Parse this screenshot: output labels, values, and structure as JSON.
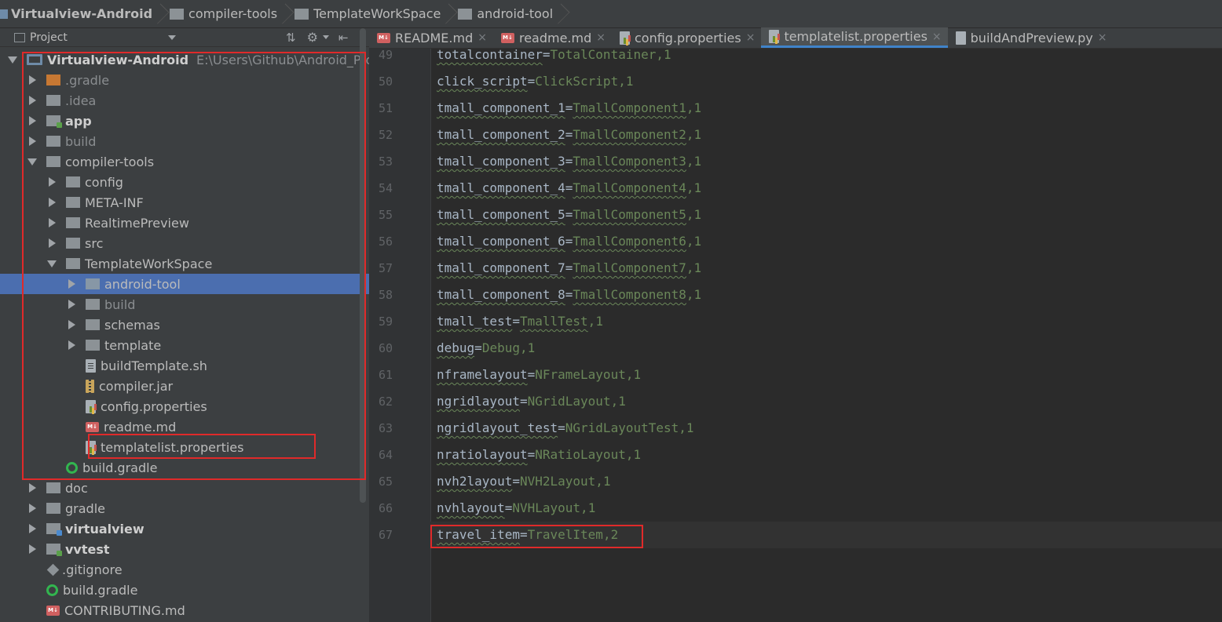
{
  "breadcrumbs": [
    "Virtualview-Android",
    "compiler-tools",
    "TemplateWorkSpace",
    "android-tool"
  ],
  "project_panel": {
    "title": "Project",
    "tree": [
      {
        "label": "Virtualview-Android",
        "path": "E:\\Users\\Github\\Android_Proje",
        "indent": 0,
        "arrow": "down",
        "icon": "project",
        "style": "bold"
      },
      {
        "label": ".gradle",
        "indent": 1,
        "arrow": "right",
        "icon": "folder-orange",
        "style": "dim"
      },
      {
        "label": ".idea",
        "indent": 1,
        "arrow": "right",
        "icon": "folder",
        "style": "dim"
      },
      {
        "label": "app",
        "indent": 1,
        "arrow": "right",
        "icon": "module",
        "style": "bold"
      },
      {
        "label": "build",
        "indent": 1,
        "arrow": "right",
        "icon": "folder",
        "style": "dim"
      },
      {
        "label": "compiler-tools",
        "indent": 1,
        "arrow": "down",
        "icon": "folder",
        "style": ""
      },
      {
        "label": "config",
        "indent": 2,
        "arrow": "right",
        "icon": "folder",
        "style": ""
      },
      {
        "label": "META-INF",
        "indent": 2,
        "arrow": "right",
        "icon": "folder",
        "style": ""
      },
      {
        "label": "RealtimePreview",
        "indent": 2,
        "arrow": "right",
        "icon": "folder",
        "style": ""
      },
      {
        "label": "src",
        "indent": 2,
        "arrow": "right",
        "icon": "folder",
        "style": ""
      },
      {
        "label": "TemplateWorkSpace",
        "indent": 2,
        "arrow": "down",
        "icon": "folder",
        "style": ""
      },
      {
        "label": "android-tool",
        "indent": 3,
        "arrow": "right",
        "icon": "folder-blue",
        "style": "",
        "selected": true
      },
      {
        "label": "build",
        "indent": 3,
        "arrow": "right",
        "icon": "folder",
        "style": "dim"
      },
      {
        "label": "schemas",
        "indent": 3,
        "arrow": "right",
        "icon": "folder",
        "style": ""
      },
      {
        "label": "template",
        "indent": 3,
        "arrow": "right",
        "icon": "folder",
        "style": ""
      },
      {
        "label": "buildTemplate.sh",
        "indent": 3,
        "arrow": "none",
        "icon": "file-sh",
        "style": ""
      },
      {
        "label": "compiler.jar",
        "indent": 3,
        "arrow": "none",
        "icon": "file-jar",
        "style": ""
      },
      {
        "label": "config.properties",
        "indent": 3,
        "arrow": "none",
        "icon": "file-props",
        "style": ""
      },
      {
        "label": "readme.md",
        "indent": 3,
        "arrow": "none",
        "icon": "file-md",
        "style": ""
      },
      {
        "label": "templatelist.properties",
        "indent": 3,
        "arrow": "none",
        "icon": "file-props",
        "style": ""
      },
      {
        "label": "build.gradle",
        "indent": 2,
        "arrow": "none",
        "icon": "gradle",
        "style": ""
      },
      {
        "label": "doc",
        "indent": 1,
        "arrow": "right",
        "icon": "folder",
        "style": ""
      },
      {
        "label": "gradle",
        "indent": 1,
        "arrow": "right",
        "icon": "folder",
        "style": ""
      },
      {
        "label": "virtualview",
        "indent": 1,
        "arrow": "right",
        "icon": "module-vv",
        "style": "bold"
      },
      {
        "label": "vvtest",
        "indent": 1,
        "arrow": "right",
        "icon": "module",
        "style": "bold"
      },
      {
        "label": ".gitignore",
        "indent": 1,
        "arrow": "none",
        "icon": "git",
        "style": ""
      },
      {
        "label": "build.gradle",
        "indent": 1,
        "arrow": "none",
        "icon": "gradle",
        "style": ""
      },
      {
        "label": "CONTRIBUTING.md",
        "indent": 1,
        "arrow": "none",
        "icon": "file-md",
        "style": ""
      }
    ]
  },
  "tabs": [
    {
      "label": "README.md",
      "icon": "file-md",
      "active": false
    },
    {
      "label": "readme.md",
      "icon": "file-md",
      "active": false
    },
    {
      "label": "config.properties",
      "icon": "file-props",
      "active": false
    },
    {
      "label": "templatelist.properties",
      "icon": "file-props",
      "active": true
    },
    {
      "label": "buildAndPreview.py",
      "icon": "file-py",
      "active": false
    }
  ],
  "editor": {
    "lines": [
      {
        "n": "49",
        "key": "totalcontainer",
        "value": "TotalContainer",
        "num": "1"
      },
      {
        "n": "50",
        "key": "click_script",
        "value": "ClickScript",
        "num": "1"
      },
      {
        "n": "51",
        "key": "tmall_component_1",
        "value": "TmallComponent1",
        "num": "1"
      },
      {
        "n": "52",
        "key": "tmall_component_2",
        "value": "TmallComponent2",
        "num": "1"
      },
      {
        "n": "53",
        "key": "tmall_component_3",
        "value": "TmallComponent3",
        "num": "1"
      },
      {
        "n": "54",
        "key": "tmall_component_4",
        "value": "TmallComponent4",
        "num": "1"
      },
      {
        "n": "55",
        "key": "tmall_component_5",
        "value": "TmallComponent5",
        "num": "1"
      },
      {
        "n": "56",
        "key": "tmall_component_6",
        "value": "TmallComponent6",
        "num": "1"
      },
      {
        "n": "57",
        "key": "tmall_component_7",
        "value": "TmallComponent7",
        "num": "1"
      },
      {
        "n": "58",
        "key": "tmall_component_8",
        "value": "TmallComponent8",
        "num": "1"
      },
      {
        "n": "59",
        "key": "tmall_test",
        "value": "TmallTest",
        "num": "1"
      },
      {
        "n": "60",
        "key": "debug",
        "value": "Debug",
        "num": "1"
      },
      {
        "n": "61",
        "key": "nframelayout",
        "value": "NFrameLayout",
        "num": "1"
      },
      {
        "n": "62",
        "key": "ngridlayout",
        "value": "NGridLayout",
        "num": "1"
      },
      {
        "n": "63",
        "key": "ngridlayout_test",
        "value": "NGridLayoutTest",
        "num": "1"
      },
      {
        "n": "64",
        "key": "nratiolayout",
        "value": "NRatioLayout",
        "num": "1"
      },
      {
        "n": "65",
        "key": "nvh2layout",
        "value": "NVH2Layout",
        "num": "1"
      },
      {
        "n": "66",
        "key": "nvhlayout",
        "value": "NVHLayout",
        "num": "1"
      },
      {
        "n": "67",
        "key": "travel_item",
        "value": "TravelItem",
        "num": "2"
      }
    ]
  },
  "colors": {
    "selection": "#4b6eaf",
    "annotation": "#e02a2a",
    "string_value": "#6a8759",
    "active_tab_underline": "#4083c9"
  }
}
